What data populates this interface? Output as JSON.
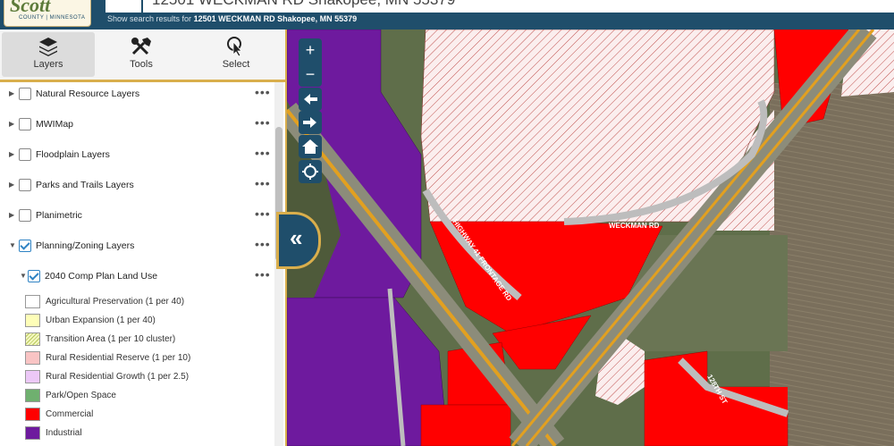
{
  "header": {
    "logo_text": "Scott",
    "logo_subtext": "COUNTY | MINNESOTA",
    "search_value": "12501 WECKMAN RD Shakopee, MN 55379",
    "search_hint_prefix": "Show search results for",
    "search_hint_address": "12501 WECKMAN RD Shakopee, MN 55379"
  },
  "tabs": [
    {
      "label": "Layers",
      "icon": "layers-icon",
      "active": true
    },
    {
      "label": "Tools",
      "icon": "tools-icon",
      "active": false
    },
    {
      "label": "Select",
      "icon": "select-cursor-icon",
      "active": false
    }
  ],
  "layers": [
    {
      "label": "Natural Resource Layers",
      "checked": false
    },
    {
      "label": "MWIMap",
      "checked": false
    },
    {
      "label": "Floodplain Layers",
      "checked": false
    },
    {
      "label": "Parks and Trails Layers",
      "checked": false
    },
    {
      "label": "Planimetric",
      "checked": false
    },
    {
      "label": "Planning/Zoning Layers",
      "checked": true,
      "expanded": true
    }
  ],
  "sublayer": {
    "label": "2040 Comp Plan Land Use",
    "checked": true,
    "expanded": true
  },
  "more_glyph": "•••",
  "legend": [
    {
      "label": "Agricultural Preservation (1 per 40)",
      "color": "#ffffff"
    },
    {
      "label": "Urban Expansion (1 per 40)",
      "color": "#fefeb8"
    },
    {
      "label": "Transition Area (1 per 10 cluster)",
      "color": "#f4f7c0",
      "hatch": true
    },
    {
      "label": "Rural Residential Reserve (1 per 10)",
      "color": "#f9c4c4"
    },
    {
      "label": "Rural Residential Growth (1 per 2.5)",
      "color": "#ecc8f7"
    },
    {
      "label": "Park/Open Space",
      "color": "#6fb06f"
    },
    {
      "label": "Commercial",
      "color": "#ff0000"
    },
    {
      "label": "Industrial",
      "color": "#6e1a9e"
    }
  ],
  "map_controls": {
    "zoom_in": "+",
    "zoom_out": "−",
    "back": "back-arrow-icon",
    "forward": "forward-arrow-icon",
    "home": "home-icon",
    "locate": "locate-icon",
    "collapse": "«"
  },
  "road_labels": {
    "weckman": "WECKMAN RD",
    "frontage": "HIGHWAY 41 FRONTAGE RD",
    "st128": "128TH ST"
  },
  "colors": {
    "header": "#1f4e6b",
    "accent": "#d9ae4c",
    "commercial": "#ff0000",
    "industrial": "#6e1a9e",
    "hatch": "#c0504d"
  }
}
